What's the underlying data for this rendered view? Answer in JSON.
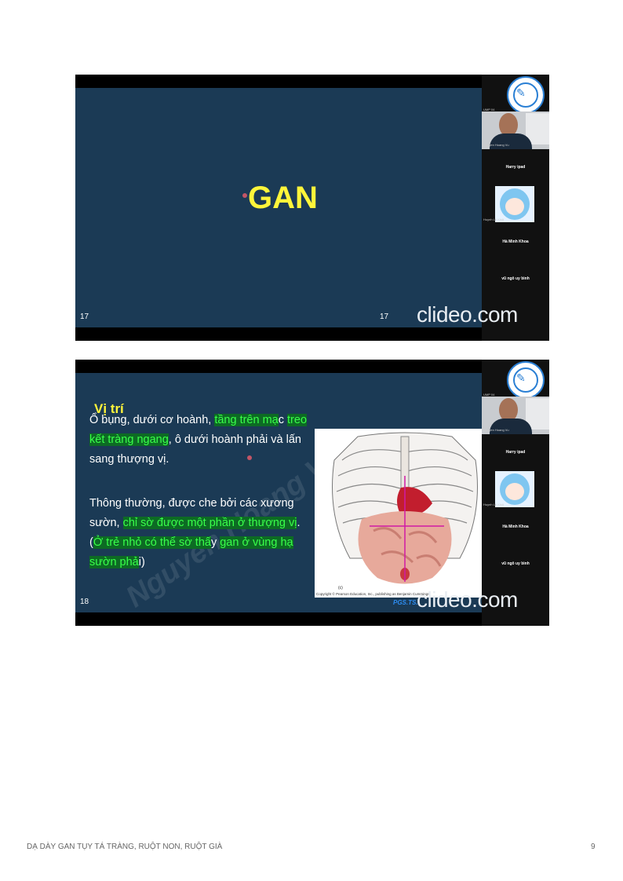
{
  "slide1": {
    "heading": "GAN",
    "number_left": "17",
    "number_right": "17",
    "watermark": "clideo.com"
  },
  "slide2": {
    "title": "Vị trí",
    "para1": {
      "t1": "Ổ bụng, dưới cơ hoành, ",
      "h1": "tầng trên mạ",
      "t2": "c ",
      "h2": "treo kết tràng ngang",
      "t3": ", ô dưới hoành phải và lấn sang thượng vị."
    },
    "para2": {
      "t1": "Thông thường, được che bởi các xương sườn, ",
      "h1": "chỉ sờ được một phần ở thượng vị",
      "t2": ". (",
      "h2": "Ở trẻ nhỏ có thể sờ thấ",
      "t3": "y ",
      "h3": "gan ở vùng hạ sườn phả",
      "t4": "i)"
    },
    "figure_label": "(c)",
    "figure_credit": "Copyright © Pearson Education, Inc., publishing as Benjamin Cummings.",
    "author": "PGS.TS.",
    "diagonal_watermark": "Nguyen Hoang Vu",
    "number_left": "18",
    "watermark": "clideo.com"
  },
  "participants": {
    "label_top": "UMP 04",
    "cam_name": "Nguyen Hoang Vu",
    "p1": "Harry ipad",
    "avatar_name": "Huynh Lê Khôi",
    "p2": "Hà Minh Khoa",
    "p3": "vũ ngô uy bình"
  },
  "footer": {
    "title": "DẠ DÀY GAN TỤY TÁ TRÀNG, RUỘT NON, RUỘT GIÀ",
    "page": "9"
  },
  "colors": {
    "slide_bg": "#1b3a55",
    "heading": "#fff53a",
    "highlight_text": "#39ff4a",
    "highlight_bg": "#0d6b24"
  }
}
